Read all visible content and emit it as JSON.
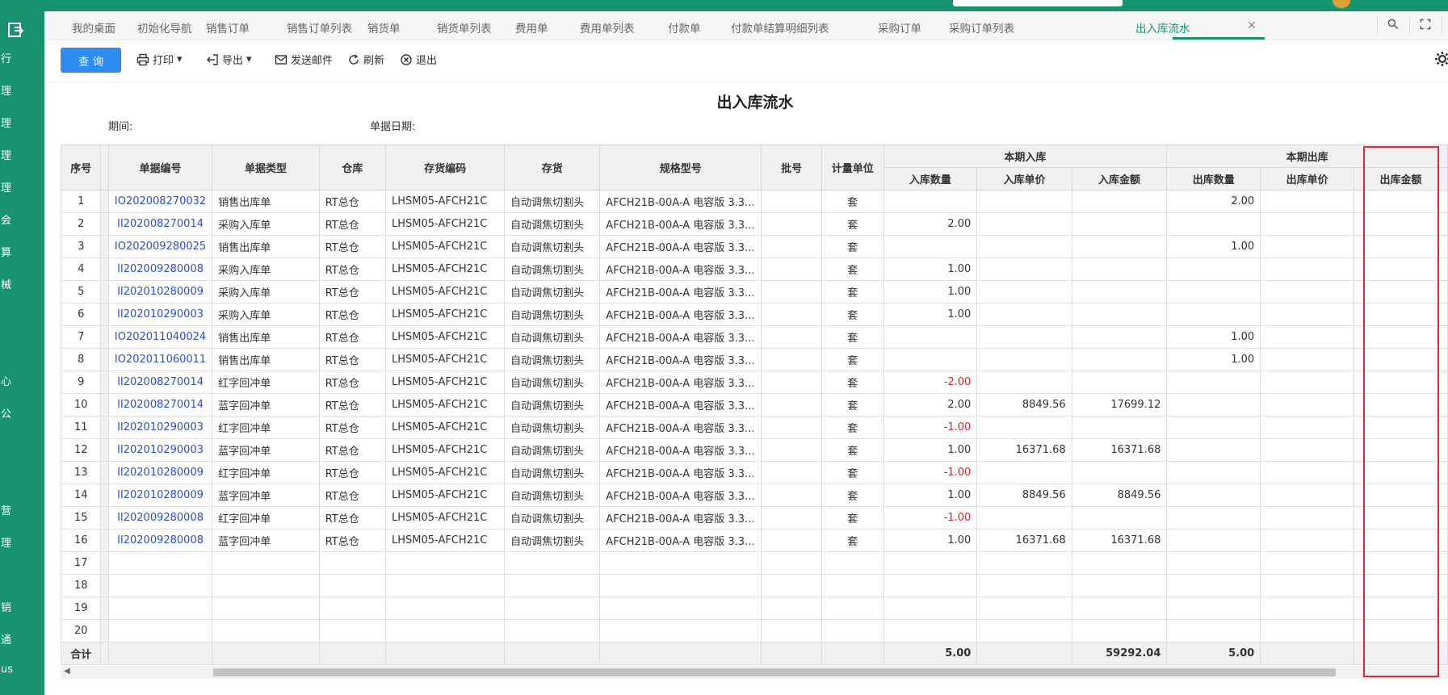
{
  "sidebar": {
    "items": [
      "行",
      "理",
      "理",
      "理",
      "理",
      "会",
      "算",
      "械",
      "心",
      "公",
      "营",
      "理",
      "销",
      "通",
      "us"
    ]
  },
  "tabs": [
    {
      "label": "我的桌面",
      "active": false
    },
    {
      "label": "初始化导航",
      "active": false
    },
    {
      "label": "销售订单",
      "active": false
    },
    {
      "label": "销售订单列表",
      "active": false
    },
    {
      "label": "销货单",
      "active": false
    },
    {
      "label": "销货单列表",
      "active": false
    },
    {
      "label": "费用单",
      "active": false
    },
    {
      "label": "费用单列表",
      "active": false
    },
    {
      "label": "付款单",
      "active": false
    },
    {
      "label": "付款单结算明细列表",
      "active": false
    },
    {
      "label": "采购订单",
      "active": false
    },
    {
      "label": "采购订单列表",
      "active": false
    },
    {
      "label": "出入库流水",
      "active": true
    }
  ],
  "toolbar": {
    "query": "查 询",
    "print": "打印",
    "export": "导出",
    "email": "发送邮件",
    "refresh": "刷新",
    "exit": "退出"
  },
  "report": {
    "title": "出入库流水",
    "period_label": "期间:",
    "date_label": "单据日期:"
  },
  "table": {
    "headers": {
      "seq": "序号",
      "doc_no": "单据编号",
      "doc_type": "单据类型",
      "warehouse": "仓库",
      "item_code": "存货编码",
      "item": "存货",
      "spec": "规格型号",
      "batch": "批号",
      "unit": "计量单位",
      "in_group": "本期入库",
      "in_qty": "入库数量",
      "in_price": "入库单价",
      "in_amount": "入库金额",
      "out_group": "本期出库",
      "out_qty": "出库数量",
      "out_price": "出库单价",
      "out_amount": "出库金额"
    },
    "rows": [
      {
        "seq": "1",
        "doc_no": "IO202008270032",
        "doc_type": "销售出库单",
        "warehouse": "RT总仓",
        "item_code": "LHSM05-AFCH21C",
        "item": "自动调焦切割头",
        "spec": "AFCH21B-00A-A 电容版 3.3...",
        "batch": "",
        "unit": "套",
        "in_qty": "",
        "in_price": "",
        "in_amount": "",
        "out_qty": "2.00",
        "out_price": "",
        "out_amount": ""
      },
      {
        "seq": "2",
        "doc_no": "II202008270014",
        "doc_type": "采购入库单",
        "warehouse": "RT总仓",
        "item_code": "LHSM05-AFCH21C",
        "item": "自动调焦切割头",
        "spec": "AFCH21B-00A-A 电容版 3.3...",
        "batch": "",
        "unit": "套",
        "in_qty": "2.00",
        "in_price": "",
        "in_amount": "",
        "out_qty": "",
        "out_price": "",
        "out_amount": ""
      },
      {
        "seq": "3",
        "doc_no": "IO202009280025",
        "doc_type": "销售出库单",
        "warehouse": "RT总仓",
        "item_code": "LHSM05-AFCH21C",
        "item": "自动调焦切割头",
        "spec": "AFCH21B-00A-A 电容版 3.3...",
        "batch": "",
        "unit": "套",
        "in_qty": "",
        "in_price": "",
        "in_amount": "",
        "out_qty": "1.00",
        "out_price": "",
        "out_amount": ""
      },
      {
        "seq": "4",
        "doc_no": "II202009280008",
        "doc_type": "采购入库单",
        "warehouse": "RT总仓",
        "item_code": "LHSM05-AFCH21C",
        "item": "自动调焦切割头",
        "spec": "AFCH21B-00A-A 电容版 3.3...",
        "batch": "",
        "unit": "套",
        "in_qty": "1.00",
        "in_price": "",
        "in_amount": "",
        "out_qty": "",
        "out_price": "",
        "out_amount": ""
      },
      {
        "seq": "5",
        "doc_no": "II202010280009",
        "doc_type": "采购入库单",
        "warehouse": "RT总仓",
        "item_code": "LHSM05-AFCH21C",
        "item": "自动调焦切割头",
        "spec": "AFCH21B-00A-A 电容版 3.3...",
        "batch": "",
        "unit": "套",
        "in_qty": "1.00",
        "in_price": "",
        "in_amount": "",
        "out_qty": "",
        "out_price": "",
        "out_amount": ""
      },
      {
        "seq": "6",
        "doc_no": "II202010290003",
        "doc_type": "采购入库单",
        "warehouse": "RT总仓",
        "item_code": "LHSM05-AFCH21C",
        "item": "自动调焦切割头",
        "spec": "AFCH21B-00A-A 电容版 3.3...",
        "batch": "",
        "unit": "套",
        "in_qty": "1.00",
        "in_price": "",
        "in_amount": "",
        "out_qty": "",
        "out_price": "",
        "out_amount": ""
      },
      {
        "seq": "7",
        "doc_no": "IO202011040024",
        "doc_type": "销售出库单",
        "warehouse": "RT总仓",
        "item_code": "LHSM05-AFCH21C",
        "item": "自动调焦切割头",
        "spec": "AFCH21B-00A-A 电容版 3.3...",
        "batch": "",
        "unit": "套",
        "in_qty": "",
        "in_price": "",
        "in_amount": "",
        "out_qty": "1.00",
        "out_price": "",
        "out_amount": ""
      },
      {
        "seq": "8",
        "doc_no": "IO202011060011",
        "doc_type": "销售出库单",
        "warehouse": "RT总仓",
        "item_code": "LHSM05-AFCH21C",
        "item": "自动调焦切割头",
        "spec": "AFCH21B-00A-A 电容版 3.3...",
        "batch": "",
        "unit": "套",
        "in_qty": "",
        "in_price": "",
        "in_amount": "",
        "out_qty": "1.00",
        "out_price": "",
        "out_amount": ""
      },
      {
        "seq": "9",
        "doc_no": "II202008270014",
        "doc_type": "红字回冲单",
        "warehouse": "RT总仓",
        "item_code": "LHSM05-AFCH21C",
        "item": "自动调焦切割头",
        "spec": "AFCH21B-00A-A 电容版 3.3...",
        "batch": "",
        "unit": "套",
        "in_qty": "-2.00",
        "in_price": "",
        "in_amount": "",
        "out_qty": "",
        "out_price": "",
        "out_amount": ""
      },
      {
        "seq": "10",
        "doc_no": "II202008270014",
        "doc_type": "蓝字回冲单",
        "warehouse": "RT总仓",
        "item_code": "LHSM05-AFCH21C",
        "item": "自动调焦切割头",
        "spec": "AFCH21B-00A-A 电容版 3.3...",
        "batch": "",
        "unit": "套",
        "in_qty": "2.00",
        "in_price": "8849.56",
        "in_amount": "17699.12",
        "out_qty": "",
        "out_price": "",
        "out_amount": ""
      },
      {
        "seq": "11",
        "doc_no": "II202010290003",
        "doc_type": "红字回冲单",
        "warehouse": "RT总仓",
        "item_code": "LHSM05-AFCH21C",
        "item": "自动调焦切割头",
        "spec": "AFCH21B-00A-A 电容版 3.3...",
        "batch": "",
        "unit": "套",
        "in_qty": "-1.00",
        "in_price": "",
        "in_amount": "",
        "out_qty": "",
        "out_price": "",
        "out_amount": ""
      },
      {
        "seq": "12",
        "doc_no": "II202010290003",
        "doc_type": "蓝字回冲单",
        "warehouse": "RT总仓",
        "item_code": "LHSM05-AFCH21C",
        "item": "自动调焦切割头",
        "spec": "AFCH21B-00A-A 电容版 3.3...",
        "batch": "",
        "unit": "套",
        "in_qty": "1.00",
        "in_price": "16371.68",
        "in_amount": "16371.68",
        "out_qty": "",
        "out_price": "",
        "out_amount": ""
      },
      {
        "seq": "13",
        "doc_no": "II202010280009",
        "doc_type": "红字回冲单",
        "warehouse": "RT总仓",
        "item_code": "LHSM05-AFCH21C",
        "item": "自动调焦切割头",
        "spec": "AFCH21B-00A-A 电容版 3.3...",
        "batch": "",
        "unit": "套",
        "in_qty": "-1.00",
        "in_price": "",
        "in_amount": "",
        "out_qty": "",
        "out_price": "",
        "out_amount": ""
      },
      {
        "seq": "14",
        "doc_no": "II202010280009",
        "doc_type": "蓝字回冲单",
        "warehouse": "RT总仓",
        "item_code": "LHSM05-AFCH21C",
        "item": "自动调焦切割头",
        "spec": "AFCH21B-00A-A 电容版 3.3...",
        "batch": "",
        "unit": "套",
        "in_qty": "1.00",
        "in_price": "8849.56",
        "in_amount": "8849.56",
        "out_qty": "",
        "out_price": "",
        "out_amount": ""
      },
      {
        "seq": "15",
        "doc_no": "II202009280008",
        "doc_type": "红字回冲单",
        "warehouse": "RT总仓",
        "item_code": "LHSM05-AFCH21C",
        "item": "自动调焦切割头",
        "spec": "AFCH21B-00A-A 电容版 3.3...",
        "batch": "",
        "unit": "套",
        "in_qty": "-1.00",
        "in_price": "",
        "in_amount": "",
        "out_qty": "",
        "out_price": "",
        "out_amount": ""
      },
      {
        "seq": "16",
        "doc_no": "II202009280008",
        "doc_type": "蓝字回冲单",
        "warehouse": "RT总仓",
        "item_code": "LHSM05-AFCH21C",
        "item": "自动调焦切割头",
        "spec": "AFCH21B-00A-A 电容版 3.3...",
        "batch": "",
        "unit": "套",
        "in_qty": "1.00",
        "in_price": "16371.68",
        "in_amount": "16371.68",
        "out_qty": "",
        "out_price": "",
        "out_amount": ""
      }
    ],
    "empty_rows": [
      "17",
      "18",
      "19",
      "20"
    ],
    "total": {
      "label": "合计",
      "in_qty": "5.00",
      "in_amount": "59292.04",
      "out_qty": "5.00"
    }
  }
}
